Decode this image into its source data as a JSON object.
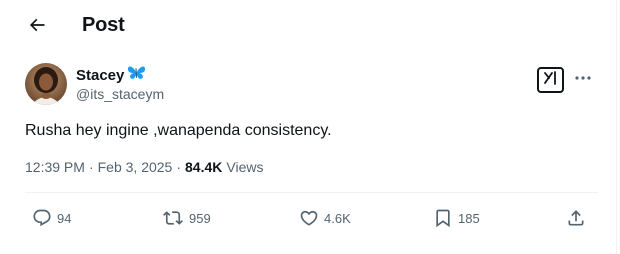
{
  "header": {
    "title": "Post",
    "back_icon": "arrow-left-icon"
  },
  "author": {
    "name": "Stacey",
    "emoji_icon": "butterfly-icon",
    "handle": "@its_staceym",
    "avatar_icon": "avatar-photo"
  },
  "tweet": {
    "text": "Rusha hey ingine ,wanapenda consistency.",
    "time": "12:39 PM",
    "separator": "·",
    "date": "Feb 3, 2025",
    "views_count": "84.4K",
    "views_label": "Views"
  },
  "actions": {
    "replies": "94",
    "reposts": "959",
    "likes": "4.6K",
    "bookmarks": "185"
  },
  "colors": {
    "text": "#0f1419",
    "secondary": "#536471",
    "border": "#eff3f4",
    "butterfly": "#1d9bf0"
  }
}
